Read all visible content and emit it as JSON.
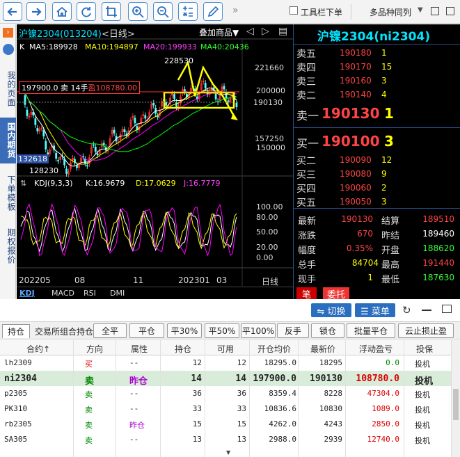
{
  "toolbar": {
    "more": "»",
    "toolbar_label": "工具栏下单",
    "multi_label": "多品种同列"
  },
  "leftnav": {
    "items": [
      "我的页面",
      "国内期货",
      "下单模板",
      "期权报价"
    ]
  },
  "chart": {
    "title": "沪镍2304(013204)",
    "period": "<日线>",
    "add_product": "叠加商品▼",
    "ma_k": "K",
    "ma5": "MA5:189928",
    "ma10": "MA10:194897",
    "ma20": "MA20:199933",
    "ma40": "MA40:20436",
    "high_label": "228530",
    "low_label": "128230",
    "left_price": "132618",
    "position_box": "197900.0  卖  14手",
    "position_pnl": "盈108780.00",
    "y_ticks": [
      "221660",
      "200000",
      "190130",
      "157250",
      "150000"
    ],
    "kdj_title": "KDJ(9,3,3)",
    "kdj_k": "K:16.9679",
    "kdj_d": "D:17.0629",
    "kdj_j": "J:16.7779",
    "kdj_ticks": [
      "100.00",
      "80.00",
      "50.00",
      "20.00",
      "0.00"
    ],
    "x_labels": [
      "202205",
      "08",
      "11",
      "202301",
      "03"
    ],
    "x_unit": "日线",
    "indicator_tabs": [
      "KDJ",
      "MACD",
      "RSI",
      "DMI"
    ],
    "chart_colors": {
      "up": "#ff3232",
      "down": "#54ffff",
      "ma5": "#ffffff",
      "ma10": "#ffff00",
      "ma20": "#ff00ff",
      "ma40": "#00ff00"
    }
  },
  "book": {
    "title": "沪镍2304(ni2304)",
    "asks": [
      {
        "label": "卖五",
        "price": "190180",
        "vol": "1"
      },
      {
        "label": "卖四",
        "price": "190170",
        "vol": "15"
      },
      {
        "label": "卖三",
        "price": "190160",
        "vol": "3"
      },
      {
        "label": "卖二",
        "price": "190140",
        "vol": "4"
      },
      {
        "label": "卖一",
        "price": "190130",
        "vol": "1"
      }
    ],
    "bids": [
      {
        "label": "买一",
        "price": "190100",
        "vol": "3"
      },
      {
        "label": "买二",
        "price": "190090",
        "vol": "12"
      },
      {
        "label": "买三",
        "price": "190080",
        "vol": "9"
      },
      {
        "label": "买四",
        "price": "190060",
        "vol": "2"
      },
      {
        "label": "买五",
        "price": "190050",
        "vol": "3"
      }
    ],
    "stats": [
      {
        "l1": "最新",
        "v1": "190130",
        "l2": "结算",
        "v2": "189510"
      },
      {
        "l1": "涨跌",
        "v1": "670",
        "l2": "昨结",
        "v2": "189460"
      },
      {
        "l1": "幅度",
        "v1": "0.35%",
        "l2": "开盘",
        "v2": "188620"
      },
      {
        "l1": "总手",
        "v1": "84704",
        "l2": "最高",
        "v2": "191440"
      },
      {
        "l1": "现手",
        "v1": "1",
        "l2": "最低",
        "v2": "187630"
      }
    ],
    "tab1": "笔",
    "tab2": "委托"
  },
  "lower": {
    "switch_label": "⇋ 切换",
    "menu_label": "☰ 菜单",
    "tabs": [
      "持仓",
      "交易所组合持仓"
    ],
    "buttons": [
      "全平",
      "平仓",
      "平30%",
      "平50%",
      "平100%",
      "反手",
      "锁仓",
      "批量平仓",
      "云止损止盈"
    ],
    "headers": [
      "合约↑",
      "方向",
      "属性",
      "持仓",
      "可用",
      "开仓均价",
      "最新价",
      "浮动盈亏",
      "投保"
    ],
    "rows": [
      {
        "c": "lh2309",
        "dir": "买",
        "attr": "--",
        "pos": "12",
        "avail": "12",
        "open": "18295.0",
        "last": "18295",
        "pnl": "0.0",
        "hedge": "投机"
      },
      {
        "c": "ni2304",
        "dir": "卖",
        "attr": "昨仓",
        "pos": "14",
        "avail": "14",
        "open": "197900.0",
        "last": "190130",
        "pnl": "108780.0",
        "hedge": "投机"
      },
      {
        "c": "p2305",
        "dir": "卖",
        "attr": "--",
        "pos": "36",
        "avail": "36",
        "open": "8359.4",
        "last": "8228",
        "pnl": "47304.0",
        "hedge": "投机"
      },
      {
        "c": "PK310",
        "dir": "卖",
        "attr": "--",
        "pos": "33",
        "avail": "33",
        "open": "10836.6",
        "last": "10830",
        "pnl": "1089.0",
        "hedge": "投机"
      },
      {
        "c": "rb2305",
        "dir": "卖",
        "attr": "昨仓",
        "pos": "15",
        "avail": "15",
        "open": "4262.0",
        "last": "4243",
        "pnl": "2850.0",
        "hedge": "投机"
      },
      {
        "c": "SA305",
        "dir": "卖",
        "attr": "--",
        "pos": "13",
        "avail": "13",
        "open": "2988.0",
        "last": "2939",
        "pnl": "12740.0",
        "hedge": "投机"
      }
    ]
  }
}
